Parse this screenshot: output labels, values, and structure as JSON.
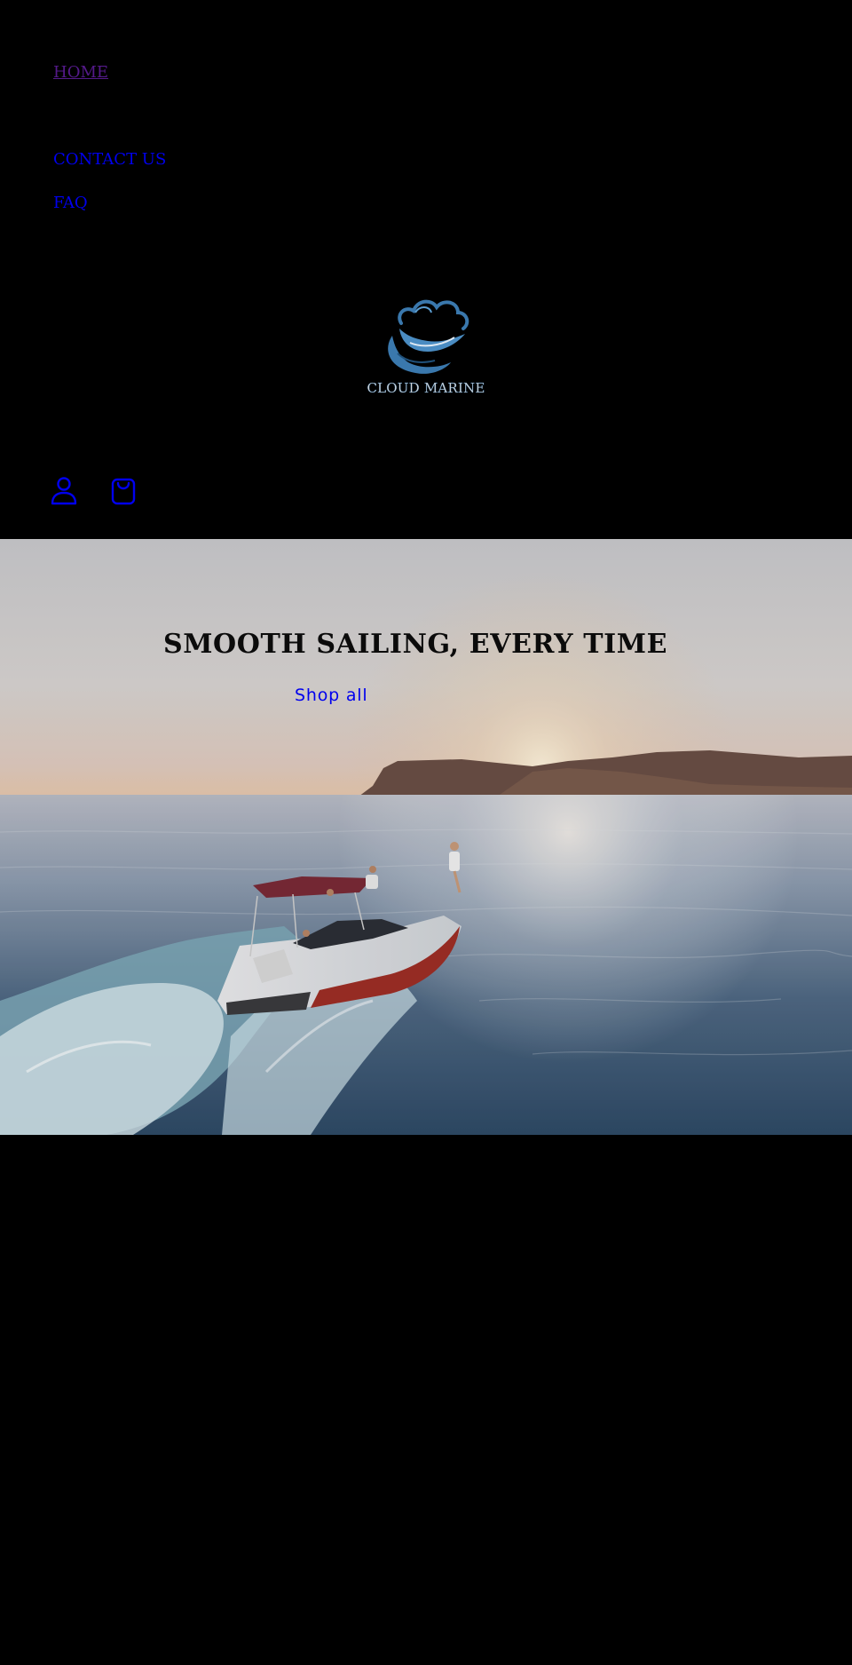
{
  "nav": {
    "items": [
      {
        "label": "HOME",
        "visited": true
      },
      {
        "label": "CONTACT US",
        "visited": false
      },
      {
        "label": "FAQ",
        "visited": false
      }
    ]
  },
  "logo": {
    "text": "CLOUD MARINE",
    "color": "#3a78ad"
  },
  "header_icons": {
    "account": "account-icon",
    "cart": "cart-icon",
    "color": "#0000ee"
  },
  "hero": {
    "title": "SMOOTH SAILING, EVERY TIME",
    "cta_label": "Shop all"
  },
  "colors": {
    "page_background": "#000000",
    "link": "#0000ee",
    "visited_link": "#551a8b"
  }
}
